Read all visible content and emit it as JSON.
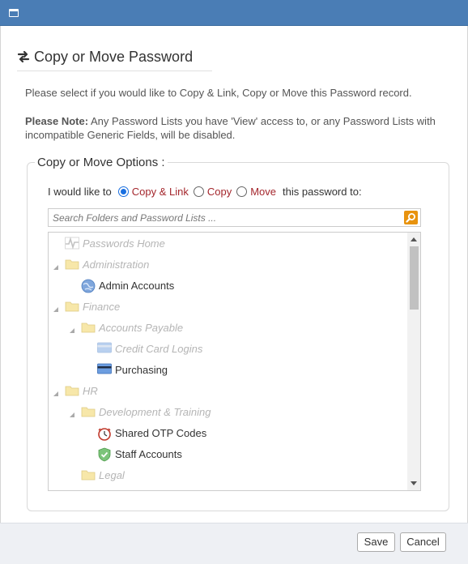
{
  "dialog": {
    "title": "Copy or Move Password",
    "intro": "Please select if you would like to Copy & Link, Copy or Move this Password record.",
    "note_bold": "Please Note:",
    "note_text": " Any Password Lists you have 'View' access to, or any Password Lists with incompatible Generic Fields, will be disabled."
  },
  "options": {
    "legend": "Copy or Move Options :",
    "prefix": "I would like to",
    "choices": [
      {
        "label": "Copy & Link",
        "selected": true
      },
      {
        "label": "Copy",
        "selected": false
      },
      {
        "label": "Move",
        "selected": false
      }
    ],
    "suffix": "this password to:"
  },
  "search": {
    "placeholder": "Search Folders and Password Lists ...",
    "value": ""
  },
  "tree": [
    {
      "label": "Passwords Home",
      "icon": "pulse-icon",
      "enabled": false,
      "expandable": false
    },
    {
      "label": "Administration",
      "icon": "folder-icon",
      "enabled": false,
      "expandable": true
    },
    {
      "label": "Admin Accounts",
      "icon": "globe-icon",
      "enabled": true,
      "expandable": false
    },
    {
      "label": "Finance",
      "icon": "folder-icon",
      "enabled": false,
      "expandable": true
    },
    {
      "label": "Accounts Payable",
      "icon": "folder-icon",
      "enabled": false,
      "expandable": true
    },
    {
      "label": "Credit Card Logins",
      "icon": "credit-card-icon",
      "enabled": false,
      "expandable": false
    },
    {
      "label": "Purchasing",
      "icon": "credit-card-icon",
      "enabled": true,
      "expandable": false
    },
    {
      "label": "HR",
      "icon": "folder-icon",
      "enabled": false,
      "expandable": true
    },
    {
      "label": "Development & Training",
      "icon": "folder-icon",
      "enabled": false,
      "expandable": true
    },
    {
      "label": "Shared OTP Codes",
      "icon": "clock-icon",
      "enabled": true,
      "expandable": false
    },
    {
      "label": "Staff Accounts",
      "icon": "shield-check-icon",
      "enabled": true,
      "expandable": false
    },
    {
      "label": "Legal",
      "icon": "folder-icon",
      "enabled": false,
      "expandable": false
    }
  ],
  "footer": {
    "save_label": "Save",
    "cancel_label": "Cancel"
  },
  "colors": {
    "titlebar": "#4a7db5",
    "option_text": "#a4262c",
    "radio_accent": "#1a6fe0",
    "search_button": "#e8930f",
    "folder": "#f6e39b"
  }
}
